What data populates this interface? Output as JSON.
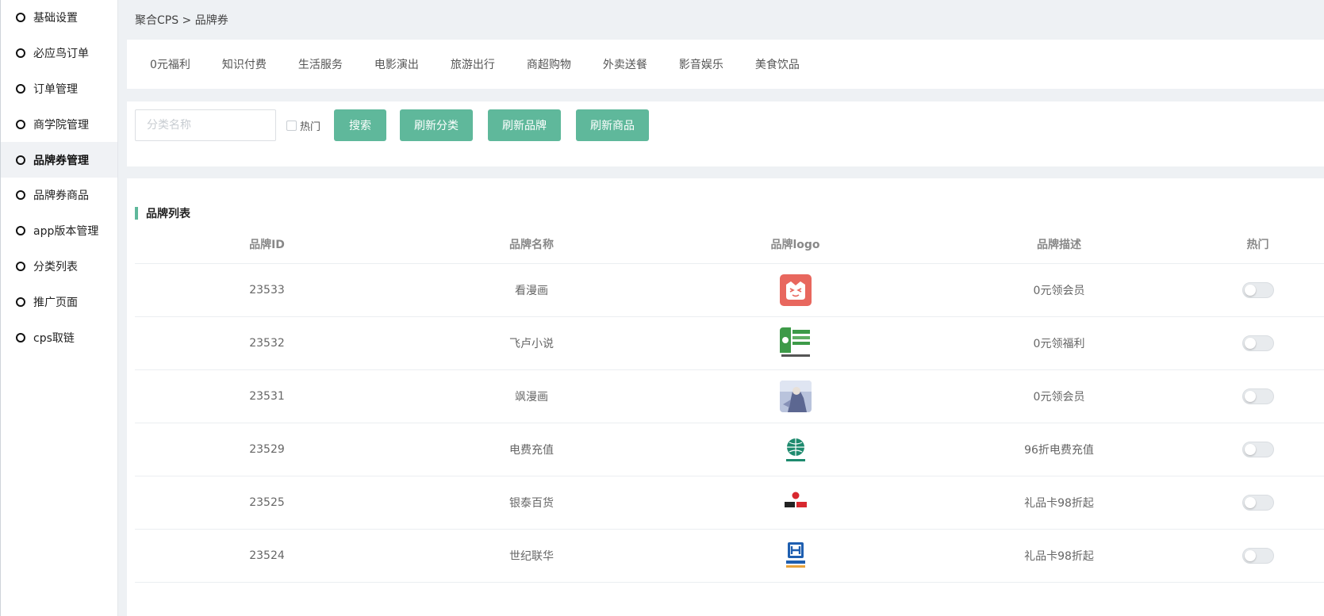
{
  "sidebar": {
    "items": [
      {
        "label": "基础设置"
      },
      {
        "label": "必应鸟订单"
      },
      {
        "label": "订单管理"
      },
      {
        "label": "商学院管理"
      },
      {
        "label": "品牌券管理"
      },
      {
        "label": "品牌券商品"
      },
      {
        "label": "app版本管理"
      },
      {
        "label": "分类列表"
      },
      {
        "label": "推广页面"
      },
      {
        "label": "cps取链"
      }
    ],
    "active_label": "品牌券管理"
  },
  "breadcrumb": "聚合CPS > 品牌券",
  "categories": [
    "0元福利",
    "知识付费",
    "生活服务",
    "电影演出",
    "旅游出行",
    "商超购物",
    "外卖送餐",
    "影音娱乐",
    "美食饮品"
  ],
  "search": {
    "placeholder": "分类名称",
    "value": "",
    "hot_label": "热门",
    "search_button": "搜索",
    "refresh_category_button": "刷新分类",
    "refresh_brand_button": "刷新品牌",
    "refresh_goods_button": "刷新商品"
  },
  "brand_list": {
    "title": "品牌列表",
    "columns": [
      "品牌ID",
      "品牌名称",
      "品牌logo",
      "品牌描述",
      "热门"
    ],
    "rows": [
      {
        "id": "23533",
        "name": "看漫画",
        "logo_icon": "kanmanhua-logo",
        "desc": "0元领会员",
        "hot": false
      },
      {
        "id": "23532",
        "name": "飞卢小说",
        "logo_icon": "feilu-logo",
        "desc": "0元领福利",
        "hot": false
      },
      {
        "id": "23531",
        "name": "飒漫画",
        "logo_icon": "samanhua-logo",
        "desc": "0元领会员",
        "hot": false
      },
      {
        "id": "23529",
        "name": "电费充值",
        "logo_icon": "state-grid-logo",
        "desc": "96折电费充值",
        "hot": false
      },
      {
        "id": "23525",
        "name": "银泰百货",
        "logo_icon": "yintai-logo",
        "desc": "礼品卡98折起",
        "hot": false
      },
      {
        "id": "23524",
        "name": "世纪联华",
        "logo_icon": "century-mart-logo",
        "desc": "礼品卡98折起",
        "hot": false
      }
    ]
  },
  "colors": {
    "accent": "#5fb89b",
    "page_background": "#eef1f4"
  }
}
